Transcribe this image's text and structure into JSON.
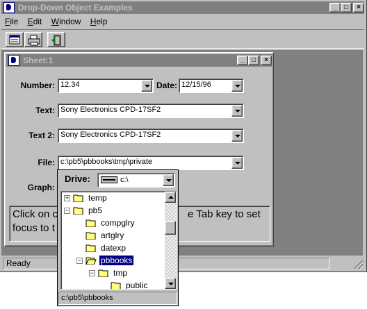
{
  "app": {
    "title": "Drop-Down Object Examples",
    "menu": [
      {
        "key": "F",
        "rest": "ile"
      },
      {
        "key": "E",
        "rest": "dit"
      },
      {
        "key": "W",
        "rest": "indow"
      },
      {
        "key": "H",
        "rest": "elp"
      }
    ],
    "status": "Ready"
  },
  "sheet": {
    "title": "Sheet:1",
    "number_label": "Number:",
    "number_value": "12.34",
    "date_label": "Date:",
    "date_value": "12/15/96",
    "text_label": "Text:",
    "text_value": "Sony Electronics CPD-17SF2",
    "text2_label": "Text 2:",
    "text2_value": "Sony Electronics CPD-17SF2",
    "file_label": "File:",
    "file_value": "c:\\pb5\\pbbooks\\tmp\\private",
    "graph_label": "Graph:",
    "help_line1_left": "Click on c",
    "help_line1_right": "e Tab key to set",
    "help_line2_left": "focus to t"
  },
  "dropdown": {
    "drive_label": "Drive:",
    "drive_value": "c:\\",
    "tree": [
      {
        "label": "temp",
        "expander": "+"
      },
      {
        "label": "pb5",
        "expander": "-"
      },
      {
        "label": "compglry",
        "expander": ""
      },
      {
        "label": "artglry",
        "expander": ""
      },
      {
        "label": "datexp",
        "expander": ""
      },
      {
        "label": "pbbooks",
        "expander": "-"
      },
      {
        "label": "tmp",
        "expander": "-"
      },
      {
        "label": "public",
        "expander": ""
      }
    ],
    "path": "c:\\pb5\\pbbooks"
  },
  "colors": {
    "face": "#c0c0c0",
    "inactive_title": "#808080",
    "selection": "#000080",
    "folder": "#ffff80"
  }
}
